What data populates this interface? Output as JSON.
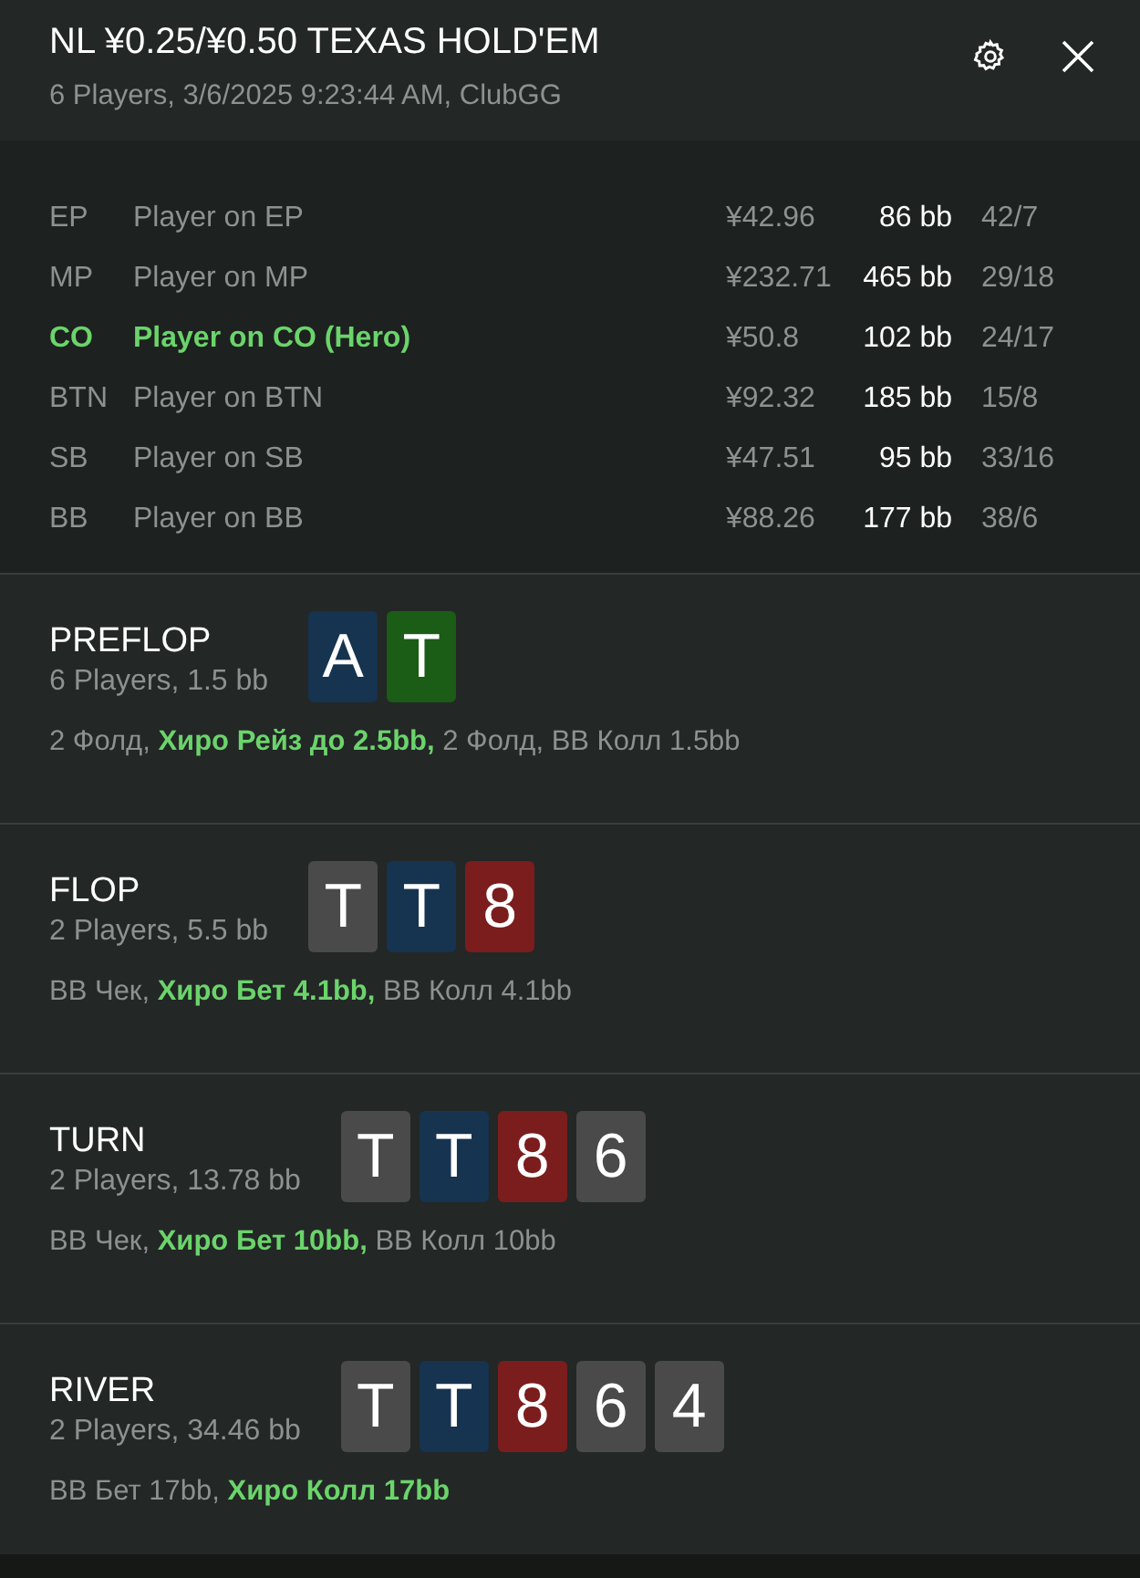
{
  "header": {
    "title": "NL ¥0.25/¥0.50 TEXAS HOLD'EM",
    "subtitle": "6 Players, 3/6/2025 9:23:44 AM, ClubGG"
  },
  "players": [
    {
      "position": "EP",
      "name": "Player on EP",
      "stack": "¥42.96",
      "bb": "86 bb",
      "stats": "42/7",
      "hero": false
    },
    {
      "position": "MP",
      "name": "Player on MP",
      "stack": "¥232.71",
      "bb": "465 bb",
      "stats": "29/18",
      "hero": false
    },
    {
      "position": "CO",
      "name": "Player on CO (Hero)",
      "stack": "¥50.8",
      "bb": "102 bb",
      "stats": "24/17",
      "hero": true
    },
    {
      "position": "BTN",
      "name": "Player on BTN",
      "stack": "¥92.32",
      "bb": "185 bb",
      "stats": "15/8",
      "hero": false
    },
    {
      "position": "SB",
      "name": "Player on SB",
      "stack": "¥47.51",
      "bb": "95 bb",
      "stats": "33/16",
      "hero": false
    },
    {
      "position": "BB",
      "name": "Player on BB",
      "stack": "¥88.26",
      "bb": "177 bb",
      "stats": "38/6",
      "hero": false
    }
  ],
  "streets": [
    {
      "name": "PREFLOP",
      "info": "6 Players, 1.5 bb",
      "cards": [
        {
          "rank": "A",
          "color": "#163350"
        },
        {
          "rank": "T",
          "color": "#1b5c16"
        }
      ],
      "actions": "2 Фолд, **Хиро Рейз до 2.5bb,** 2 Фолд, BB Колл 1.5bb"
    },
    {
      "name": "FLOP",
      "info": "2 Players, 5.5 bb",
      "cards": [
        {
          "rank": "T",
          "color": "#4a4a4a"
        },
        {
          "rank": "T",
          "color": "#163350"
        },
        {
          "rank": "8",
          "color": "#7b1d1d"
        }
      ],
      "actions": "BB Чек, **Хиро Бет 4.1bb,** BB Колл 4.1bb"
    },
    {
      "name": "TURN",
      "info": "2 Players, 13.78 bb",
      "cards": [
        {
          "rank": "T",
          "color": "#4a4a4a"
        },
        {
          "rank": "T",
          "color": "#163350"
        },
        {
          "rank": "8",
          "color": "#7b1d1d"
        },
        {
          "rank": "6",
          "color": "#4a4a4a"
        }
      ],
      "actions": "BB Чек, **Хиро Бет 10bb,** BB Колл 10bb"
    },
    {
      "name": "RIVER",
      "info": "2 Players, 34.46 bb",
      "cards": [
        {
          "rank": "T",
          "color": "#4a4a4a"
        },
        {
          "rank": "T",
          "color": "#163350"
        },
        {
          "rank": "8",
          "color": "#7b1d1d"
        },
        {
          "rank": "6",
          "color": "#4a4a4a"
        },
        {
          "rank": "4",
          "color": "#4a4a4a"
        }
      ],
      "actions": "BB Бет 17bb, **Хиро Колл 17bb**"
    }
  ]
}
